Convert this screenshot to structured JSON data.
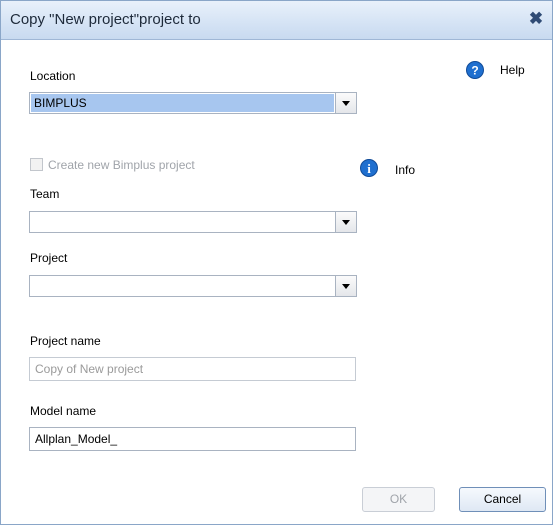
{
  "dialog": {
    "title": "Copy \"New project\"project to",
    "close_glyph": "✖"
  },
  "help": {
    "label": "Help"
  },
  "info": {
    "label": "Info"
  },
  "location": {
    "label": "Location",
    "value": "BIMPLUS"
  },
  "create_new": {
    "label": "Create new Bimplus project",
    "checked": false,
    "enabled": false
  },
  "team": {
    "label": "Team",
    "value": ""
  },
  "project": {
    "label": "Project",
    "value": ""
  },
  "project_name": {
    "label": "Project name",
    "placeholder": "Copy of New project"
  },
  "model_name": {
    "label": "Model name",
    "value": "Allplan_Model_"
  },
  "buttons": {
    "ok": "OK",
    "cancel": "Cancel"
  },
  "colors": {
    "title_gradient_top": "#e9f1fb",
    "title_gradient_bottom": "#c8daf0",
    "selection": "#a7c6ef",
    "icon_blue": "#1f6fcf"
  }
}
